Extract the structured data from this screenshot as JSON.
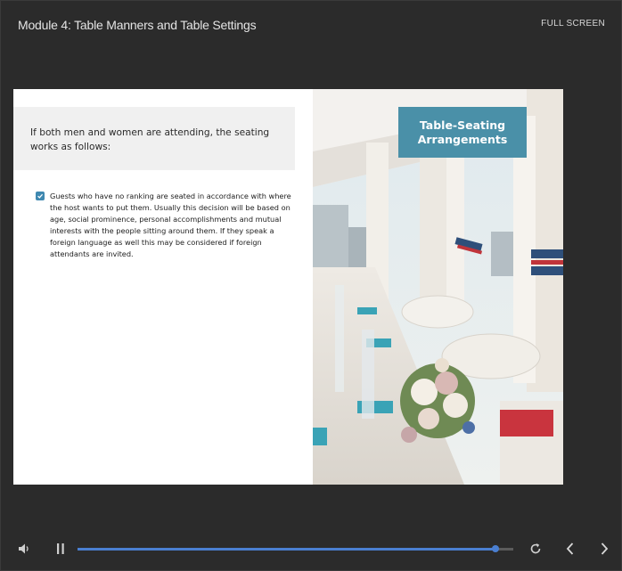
{
  "header": {
    "title": "Module 4: Table Manners and Table Settings",
    "fullscreen_label": "FULL SCREEN"
  },
  "slide": {
    "intro": "If both men and women are attending, the seating works as follows:",
    "bullets": [
      {
        "checked": true,
        "text": "Guests who have no ranking are seated in accordance with where the host wants to put them. Usually this decision will be based on age, social prominence, personal accomplishments and mutual interests with the people sitting around them. If they speak a foreign language as well this may be considered if foreign attendants are invited."
      }
    ],
    "caption": "Table-Seating Arrangements",
    "accent_color": "#4a90a8"
  },
  "player": {
    "progress": 0.96,
    "icons": {
      "volume": "volume-icon",
      "pause": "pause-icon",
      "replay": "replay-icon",
      "previous": "chevron-left-icon",
      "next": "chevron-right-icon"
    },
    "seek_color": "#4a7fd1"
  }
}
